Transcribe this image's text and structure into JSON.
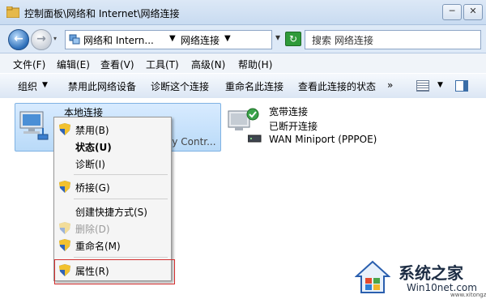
{
  "window": {
    "title": "控制面板\\网络和 Internet\\网络连接",
    "buttons": {
      "minimize": "─",
      "close": "✕"
    }
  },
  "address": {
    "segments": [
      "网络和 Intern...",
      "▼",
      "网络连接",
      "▼"
    ],
    "dropdown": "▾",
    "refresh": "▾",
    "go": "↻",
    "search_placeholder": "搜索 网络连接"
  },
  "menu": [
    "文件(F)",
    "编辑(E)",
    "查看(V)",
    "工具(T)",
    "高级(N)",
    "帮助(H)"
  ],
  "commands": {
    "organize": "组织",
    "organize_caret": "▼",
    "disable": "禁用此网络设备",
    "diagnose": "诊断这个连接",
    "rename": "重命名此连接",
    "view_status": "查看此连接的状态",
    "more": "»",
    "view_caret": "▼"
  },
  "connections": {
    "local": {
      "name": "本地连接",
      "device": "ly Contr..."
    },
    "broadband": {
      "name": "宽带连接",
      "status": "已断开连接",
      "device": "WAN Miniport (PPPOE)"
    }
  },
  "context_menu": [
    {
      "label": "禁用(B)",
      "shield": true,
      "style": "normal"
    },
    {
      "label": "状态(U)",
      "shield": false,
      "style": "bold"
    },
    {
      "label": "诊断(I)",
      "shield": false,
      "style": "normal"
    },
    {
      "label": "桥接(G)",
      "shield": true,
      "style": "normal"
    },
    {
      "label": "创建快捷方式(S)",
      "shield": false,
      "style": "normal"
    },
    {
      "label": "删除(D)",
      "shield": true,
      "style": "disabled"
    },
    {
      "label": "重命名(M)",
      "shield": true,
      "style": "normal"
    },
    {
      "label": "属性(R)",
      "shield": true,
      "style": "normal"
    }
  ],
  "watermark": {
    "title": "系统之家",
    "site": "Win10net.com",
    "small": "www.xitongzhijia.net"
  },
  "colors": {
    "highlight": "#d32e2e",
    "selection": "#b9daf8",
    "shield_blue": "#2f63b8",
    "shield_yellow": "#f2c12e"
  },
  "icons": [
    "folder-icon",
    "back-arrow-icon",
    "forward-arrow-icon",
    "refresh-icon",
    "computer-icon",
    "network-icon",
    "shield-icon",
    "check-badge-icon",
    "modem-icon",
    "view-icon",
    "preview-pane-icon"
  ]
}
